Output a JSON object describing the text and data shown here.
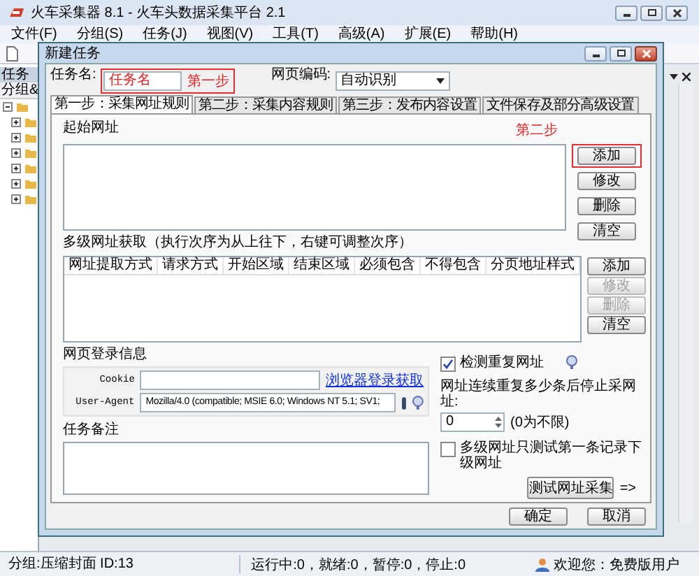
{
  "main_window": {
    "title": "火车采集器 8.1 - 火车头数据采集平台 2.1",
    "menu": [
      {
        "label": "文件(F)"
      },
      {
        "label": "分组(S)"
      },
      {
        "label": "任务(J)"
      },
      {
        "label": "视图(V)"
      },
      {
        "label": "工具(T)"
      },
      {
        "label": "高级(A)"
      },
      {
        "label": "扩展(E)"
      },
      {
        "label": "帮助(H)"
      }
    ],
    "left_panel": {
      "header": "任务",
      "filter": "分组&",
      "tree": [
        {
          "expanded": true,
          "children": [
            {
              "expanded": false
            },
            {
              "expanded": false
            },
            {
              "expanded": false
            },
            {
              "expanded": false
            },
            {
              "expanded": false
            },
            {
              "expanded": false
            }
          ]
        }
      ]
    },
    "status_bar": {
      "group": "分组:压缩封面  ID:13",
      "counts": "运行中:0，就绪:0，暂停:0，停止:0",
      "user": "欢迎您：免费版用户"
    }
  },
  "dialog": {
    "title": "新建任务",
    "task_name": {
      "label": "任务名:",
      "value": "任务名",
      "annotation": "第一步"
    },
    "encoding": {
      "label": "网页编码:",
      "value": "自动识别"
    },
    "tabs": [
      {
        "label": "第一步：采集网址规则",
        "selected": true
      },
      {
        "label": "第二步：采集内容规则",
        "selected": false
      },
      {
        "label": "第三步：发布内容设置",
        "selected": false
      },
      {
        "label": "文件保存及部分高级设置",
        "selected": false
      }
    ],
    "start_urls": {
      "label": "起始网址",
      "annotation": "第二步",
      "buttons": [
        {
          "label": "添加",
          "disabled": false,
          "highlighted": true
        },
        {
          "label": "修改",
          "disabled": false,
          "highlighted": false
        },
        {
          "label": "删除",
          "disabled": false,
          "highlighted": false
        },
        {
          "label": "清空",
          "disabled": false,
          "highlighted": false
        }
      ]
    },
    "multi_level": {
      "label": "多级网址获取（执行次序为从上往下，右键可调整次序）",
      "columns": [
        "网址提取方式",
        "请求方式",
        "开始区域",
        "结束区域",
        "必须包含",
        "不得包含",
        "分页地址样式"
      ],
      "buttons": [
        {
          "label": "添加",
          "disabled": false
        },
        {
          "label": "修改",
          "disabled": true
        },
        {
          "label": "删除",
          "disabled": true
        },
        {
          "label": "清空",
          "disabled": false
        }
      ]
    },
    "login": {
      "label": "网页登录信息",
      "cookie_label": "Cookie",
      "cookie_link": "浏览器登录获取",
      "ua_label": "User-Agent",
      "ua_value": "Mozilla/4.0 (compatible; MSIE 6.0; Windows NT 5.1; SV1; "
    },
    "check_duplicates": {
      "label": "检测重复网址",
      "checked": true
    },
    "repeat_limit": {
      "label": "网址连续重复多少条后停止采网址:",
      "value": "0",
      "hint": "(0为不限)"
    },
    "notes": {
      "label": "任务备注"
    },
    "test_first_only": {
      "label": "多级网址只测试第一条记录下级网址",
      "checked": false
    },
    "test_button": "测试网址采集",
    "arrow": "=>",
    "footer_buttons": [
      "确定",
      "取消"
    ]
  }
}
